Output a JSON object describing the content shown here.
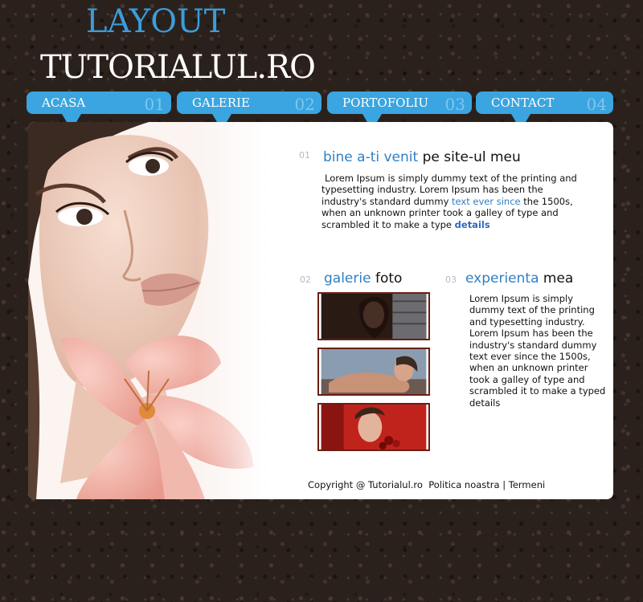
{
  "header": {
    "logo_small": "LAYOUT",
    "logo_big": "TUTORIALUL.RO"
  },
  "nav": [
    {
      "label": "ACASA",
      "num": "01"
    },
    {
      "label": "GALERIE",
      "num": "02"
    },
    {
      "label": "PORTOFOLIU",
      "num": "03"
    },
    {
      "label": "CONTACT",
      "num": "04"
    }
  ],
  "welcome": {
    "num": "01",
    "title_accent": "bine a-ti venit",
    "title_rest": "pe site-ul meu",
    "text_a": "Lorem Ipsum is simply dummy text of the printing and typesetting industry. Lorem Ipsum has been the industry's standard dummy",
    "text_link": "text ever since",
    "text_b": "the 1500s, when an unknown printer took a galley of type and scrambled it to make a type",
    "details_label": "details"
  },
  "gallery": {
    "num": "02",
    "title_accent": "galerie",
    "title_rest": "foto"
  },
  "experience": {
    "num": "03",
    "title_accent": "experienta",
    "title_rest": "mea",
    "text": "Lorem Ipsum is simply dummy text of the printing and typesetting industry. Lorem Ipsum has been the industry's standard dummy text ever since the 1500s, when an unknown printer took a galley of type and scrambled it to make a typed details"
  },
  "footer": {
    "copyright": "Copyright @ Tutorialul.ro",
    "policy_link": "Politica noastra",
    "separator": "|",
    "terms_link": "Termeni"
  },
  "colors": {
    "accent": "#3aa5e0",
    "link": "#2f7fc4",
    "background": "#2b211c"
  }
}
